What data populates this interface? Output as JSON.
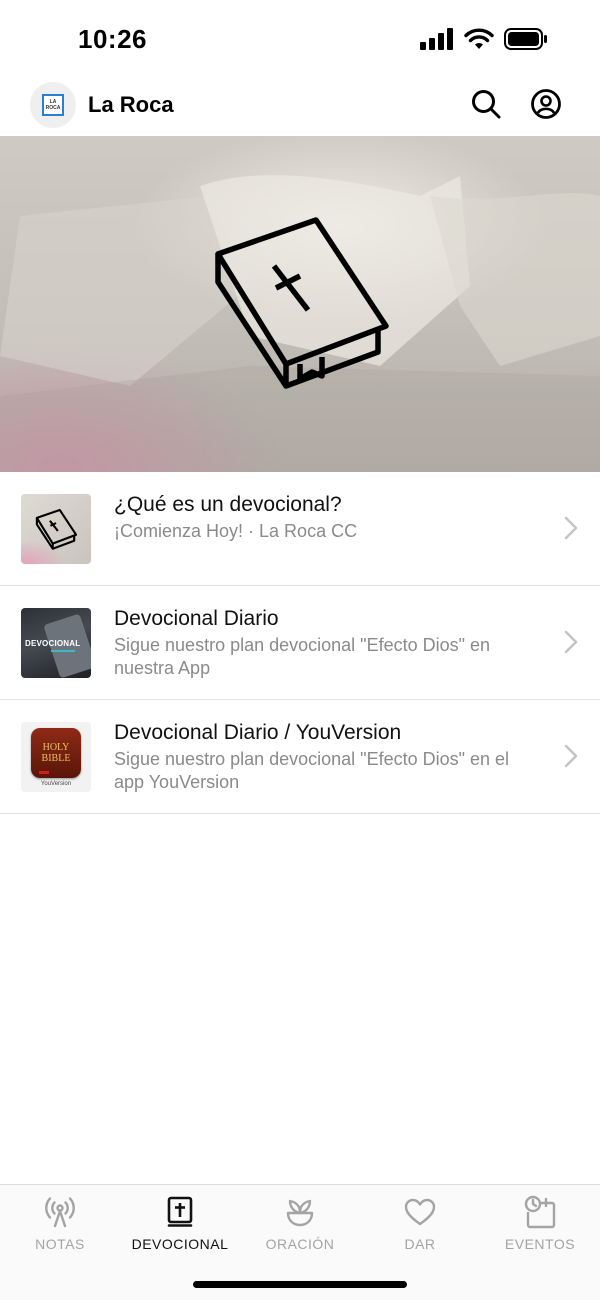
{
  "status_bar": {
    "time": "10:26"
  },
  "header": {
    "logo_text_top": "LA",
    "logo_text_bottom": "ROCA",
    "title": "La Roca",
    "search_icon": "search-icon",
    "profile_icon": "user-circle-icon"
  },
  "hero": {
    "icon": "bible-icon"
  },
  "items": [
    {
      "title": "¿Qué es un devocional?",
      "subtitle": "¡Comienza Hoy! · La Roca CC",
      "thumb_icon": "bible-icon"
    },
    {
      "title": "Devocional Diario",
      "subtitle": "Sigue nuestro plan devocional \"Efecto Dios\" en nuestra App",
      "thumb_text": "DEVOCIONAL"
    },
    {
      "title": "Devocional Diario / YouVersion",
      "subtitle": "Sigue nuestro plan devocional \"Efecto Dios\" en el app YouVersion",
      "thumb_text_top": "HOLY",
      "thumb_text_bottom": "BIBLE",
      "thumb_caption": "YouVersion"
    }
  ],
  "tabs": [
    {
      "label": "NOTAS",
      "icon": "broadcast-icon",
      "active": false
    },
    {
      "label": "DEVOCIONAL",
      "icon": "bible-icon",
      "active": true
    },
    {
      "label": "ORACIÓN",
      "icon": "plant-icon",
      "active": false
    },
    {
      "label": "DAR",
      "icon": "heart-icon",
      "active": false
    },
    {
      "label": "EVENTOS",
      "icon": "calendar-clock-icon",
      "active": false
    }
  ],
  "colors": {
    "active_tab": "#111111",
    "inactive_tab": "#a4a4a4",
    "subtitle": "#8a8a8a"
  }
}
